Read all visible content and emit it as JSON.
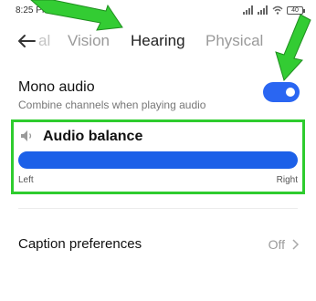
{
  "status_bar": {
    "time": "8:25 PM",
    "battery": "40"
  },
  "tabs": [
    {
      "label": "al"
    },
    {
      "label": "Vision"
    },
    {
      "label": "Hearing",
      "active": true
    },
    {
      "label": "Physical"
    }
  ],
  "mono_audio": {
    "title": "Mono audio",
    "subtitle": "Combine channels when playing audio",
    "enabled": true
  },
  "audio_balance": {
    "title": "Audio balance",
    "left_label": "Left",
    "right_label": "Right"
  },
  "caption_preferences": {
    "title": "Caption preferences",
    "value": "Off"
  },
  "colors": {
    "accent": "#2a66f2",
    "highlight": "#2ecc2e"
  }
}
